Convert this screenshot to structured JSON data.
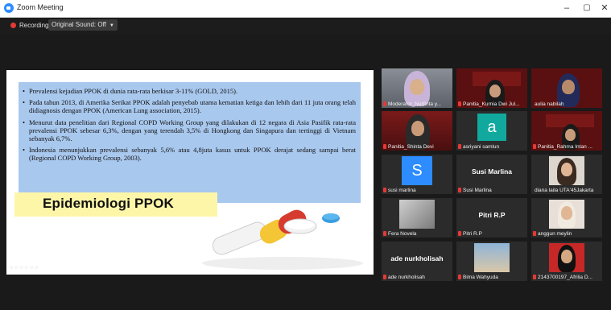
{
  "window": {
    "title": "Zoom Meeting"
  },
  "window_controls": {
    "minimize": "–",
    "maximize": "▢",
    "close": "✕"
  },
  "toolbar": {
    "recording_label": "Recording",
    "sound_label": "Original Sound: Off",
    "sound_caret": "▼"
  },
  "slide": {
    "bullets": [
      "Prevalensi kejadian PPOK di dunia rata-rata berkisar 3-11% (GOLD, 2015).",
      "Pada tahun 2013, di Amerika Serikat PPOK adalah penyebab utama kematian ketiga dan lebih dari 11 juta orang telah didiagnosis dengan PPOK (American Lung association, 2015).",
      "Menurut data penelitian dari Regional COPD Working Group yang dilakukan di 12 negara di Asia Pasifik rata-rata prevalensi PPOK sebesar 6,3%, dengan yang terendah 3,5% di Hongkong dan Singapura dan tertinggi di Vietnam sebanyak 6,7%.",
      "Indonesia menunjukkan prevalensi sebanyak 5,6% atau 4,8juta kasus untuk PPOK derajat sedang sampai berat (Regional COPD Working Group, 2003)."
    ],
    "title": "Epidemiologi PPOK"
  },
  "participants": [
    {
      "name": "Moderator_Nurfinta y...",
      "muted": true
    },
    {
      "name": "Panitia_Kurnia Dwi Jul...",
      "muted": true
    },
    {
      "name": "aulia nabilah",
      "muted": false
    },
    {
      "name": "Panitia_Shinta Devi",
      "muted": true
    },
    {
      "name": "asriyani samlun",
      "muted": true,
      "avatar_letter": "a"
    },
    {
      "name": "Panitia_Rahma Intan ...",
      "muted": true
    },
    {
      "name": "susi marlina",
      "muted": true,
      "avatar_letter": "S"
    },
    {
      "name": "Susi Marlina",
      "muted": true
    },
    {
      "name": "diana laila UTA'45Jakarta",
      "muted": false
    },
    {
      "name": "Fera Novela",
      "muted": true
    },
    {
      "name": "Pitri R.P",
      "muted": true
    },
    {
      "name": "anggun meylin",
      "muted": true
    },
    {
      "name": "ade nurkholisah",
      "muted": true
    },
    {
      "name": "Bima Wahyuda",
      "muted": true
    },
    {
      "name": "2143700197_Afrilia D...",
      "muted": true
    }
  ],
  "colors": {
    "active_speaker_border": "#8dd36a",
    "recording_dot": "#e53935",
    "zoom_blue": "#2d8cff"
  }
}
